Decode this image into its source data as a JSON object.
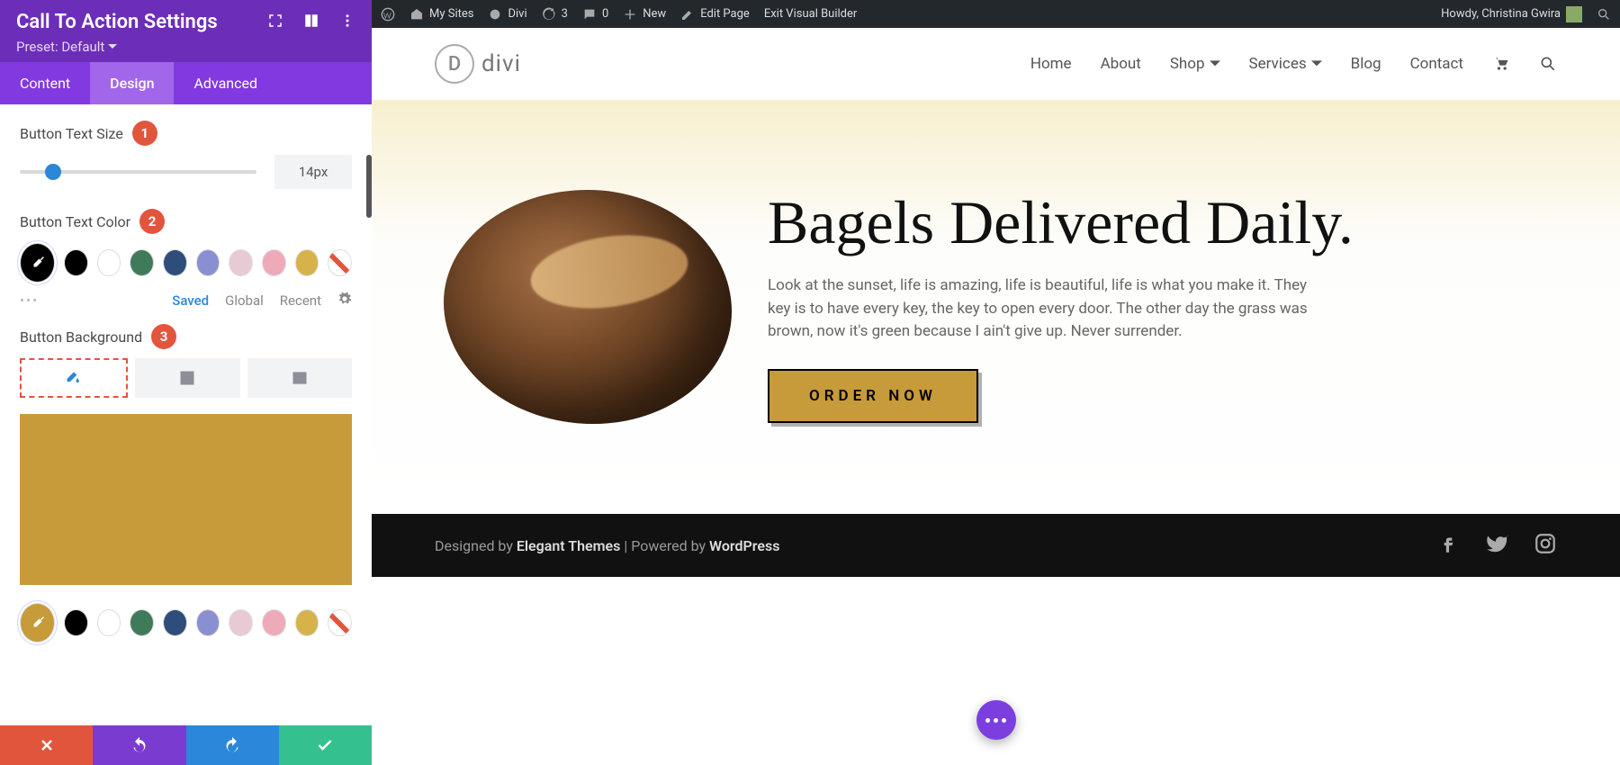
{
  "panel": {
    "title": "Call To Action Settings",
    "preset": "Preset: Default",
    "tabs": {
      "content": "Content",
      "design": "Design",
      "advanced": "Advanced"
    },
    "text_size_label": "Button Text Size",
    "text_size_value": "14px",
    "text_color_label": "Button Text Color",
    "bg_label": "Button Background",
    "callouts": {
      "one": "1",
      "two": "2",
      "three": "3"
    },
    "saved_tabs": {
      "saved": "Saved",
      "global": "Global",
      "recent": "Recent"
    },
    "swatches_main": [
      "#000000",
      "#ffffff",
      "#3f7a5a",
      "#2f4d7a",
      "#8a8fd1",
      "#e8cad4",
      "#efaaba",
      "#d6b24a"
    ],
    "preview_color": "#c79a3a"
  },
  "wp": {
    "mysites": "My Sites",
    "sitename": "Divi",
    "updates": "3",
    "comments": "0",
    "new": "New",
    "edit": "Edit Page",
    "exit": "Exit Visual Builder",
    "howdy": "Howdy, Christina Gwira"
  },
  "site": {
    "logo_text": "divi",
    "nav": {
      "home": "Home",
      "about": "About",
      "shop": "Shop",
      "services": "Services",
      "blog": "Blog",
      "contact": "Contact"
    },
    "hero_title": "Bagels Delivered Daily.",
    "hero_body": "Look at the sunset, life is amazing, life is beautiful, life is what you make it. They key is to have every key, the key to open every door. The other day the grass was brown, now it's green because I ain't give up. Never surrender.",
    "hero_button": "ORDER NOW",
    "footer_prefix": "Designed by ",
    "footer_et": "Elegant Themes",
    "footer_mid": " | Powered by ",
    "footer_wp": "WordPress"
  }
}
